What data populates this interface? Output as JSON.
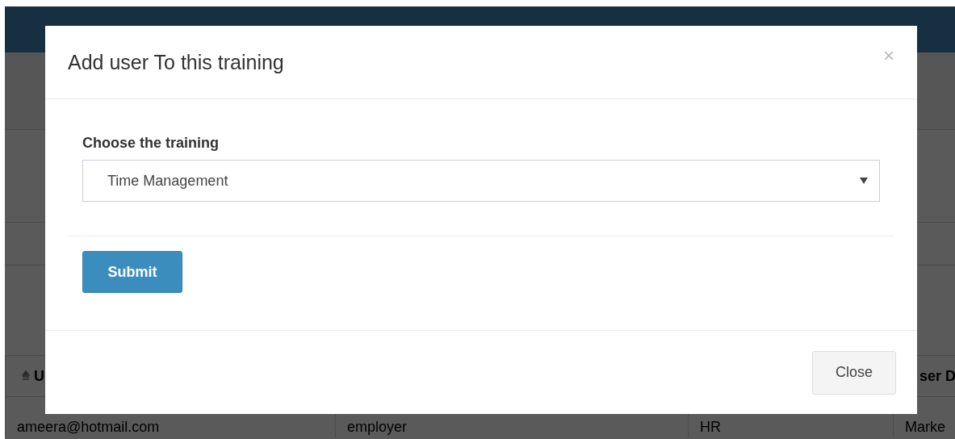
{
  "background_table": {
    "header": [
      "U",
      "ser D"
    ],
    "row": [
      "ameera@hotmail.com",
      "employer",
      "HR",
      "Marke"
    ]
  },
  "modal": {
    "title": "Add user To this training",
    "close_symbol": "×",
    "field_label": "Choose the training",
    "select_value": "Time Management",
    "submit_button": "Submit",
    "close_button": "Close"
  }
}
